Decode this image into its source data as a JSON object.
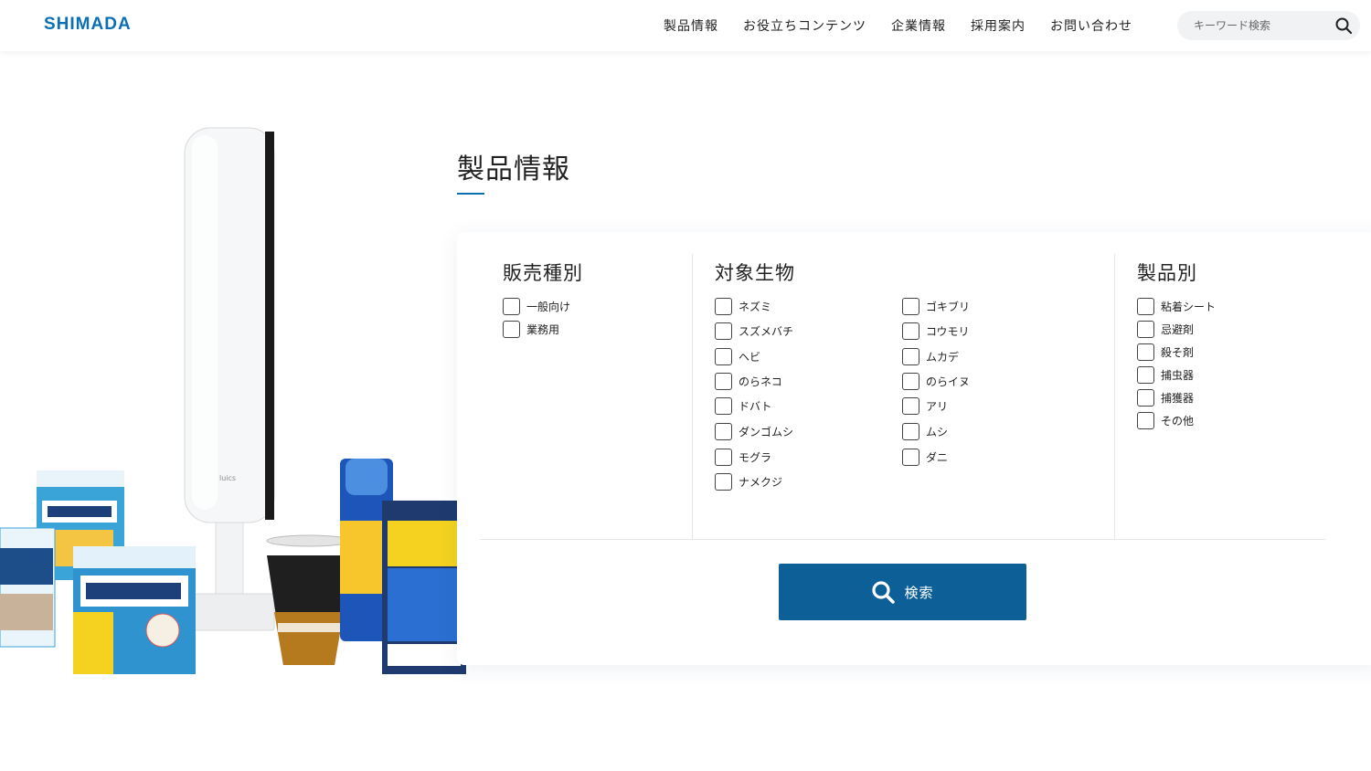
{
  "header": {
    "logo": "SHIMADA",
    "nav": [
      "製品情報",
      "お役立ちコンテンツ",
      "企業情報",
      "採用案内",
      "お問い合わせ"
    ],
    "search_placeholder": "キーワード検索"
  },
  "page": {
    "title": "製品情報"
  },
  "filters": {
    "sales": {
      "title": "販売種別",
      "items": [
        "一般向け",
        "業務用"
      ]
    },
    "target": {
      "title": "対象生物",
      "left": [
        "ネズミ",
        "スズメバチ",
        "ヘビ",
        "のらネコ",
        "ドバト",
        "ダンゴムシ",
        "モグラ",
        "ナメクジ"
      ],
      "right": [
        "ゴキブリ",
        "コウモリ",
        "ムカデ",
        "のらイヌ",
        "アリ",
        "ムシ",
        "ダニ"
      ]
    },
    "product": {
      "title": "製品別",
      "items": [
        "粘着シート",
        "忌避剤",
        "殺そ剤",
        "捕虫器",
        "捕獲器",
        "その他"
      ]
    },
    "submit_label": "検索"
  },
  "hero": {
    "device_label": "luics"
  },
  "colors": {
    "brand": "#0a6fb5",
    "button": "#0d5f97"
  }
}
